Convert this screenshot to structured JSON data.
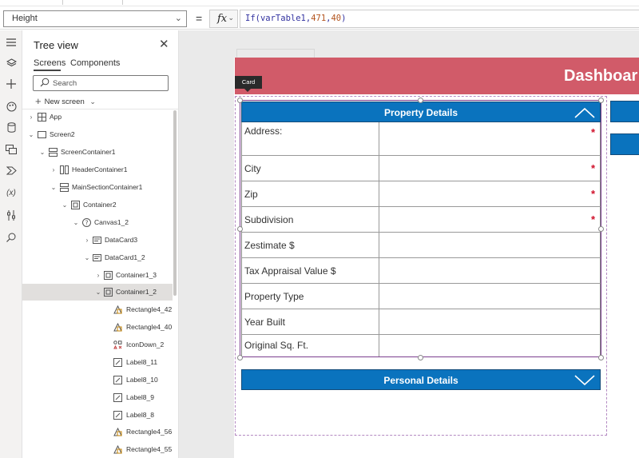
{
  "formula_bar": {
    "property": "Height",
    "fx_label": "fx",
    "formula_prefix": "If(varTable1,",
    "formula_num1": "471",
    "formula_comma": ",",
    "formula_num2": "40",
    "formula_suffix": ")"
  },
  "rail": {
    "icons": [
      "menu-icon",
      "layers-icon",
      "insert-icon",
      "theme-icon",
      "data-icon",
      "media-icon",
      "power-automate-icon",
      "variables-icon",
      "tools-icon",
      "search-icon"
    ]
  },
  "tree_view": {
    "title": "Tree view",
    "tabs": {
      "screens": "Screens",
      "components": "Components"
    },
    "search_placeholder": "Search",
    "new_screen": "New screen",
    "items": [
      {
        "label": "App"
      },
      {
        "label": "Screen2"
      },
      {
        "label": "ScreenContainer1"
      },
      {
        "label": "HeaderContainer1"
      },
      {
        "label": "MainSectionContainer1"
      },
      {
        "label": "Container2"
      },
      {
        "label": "Canvas1_2"
      },
      {
        "label": "DataCard3"
      },
      {
        "label": "DataCard1_2"
      },
      {
        "label": "Container1_3"
      },
      {
        "label": "Container1_2"
      },
      {
        "label": "Rectangle4_42"
      },
      {
        "label": "Rectangle4_40"
      },
      {
        "label": "IconDown_2"
      },
      {
        "label": "Label8_11"
      },
      {
        "label": "Label8_10"
      },
      {
        "label": "Label8_9"
      },
      {
        "label": "Label8_8"
      },
      {
        "label": "Rectangle4_56"
      },
      {
        "label": "Rectangle4_55"
      }
    ]
  },
  "canvas": {
    "header_title": "Dashboar",
    "card_tag": "Card",
    "property_section": "Property Details",
    "personal_section": "Personal Details",
    "required_mark": "*",
    "fields": [
      {
        "label": "Address:",
        "required": true
      },
      {
        "label": "City",
        "required": true
      },
      {
        "label": "Zip",
        "required": true
      },
      {
        "label": "Subdivision",
        "required": true
      },
      {
        "label": "Zestimate $",
        "required": false
      },
      {
        "label": "Tax Appraisal Value $",
        "required": false
      },
      {
        "label": "Property Type",
        "required": false
      },
      {
        "label": "Year Built",
        "required": false
      },
      {
        "label": "Original Sq. Ft.",
        "required": false
      }
    ],
    "colors": {
      "header": "#d15b69",
      "section": "#0a73be",
      "selection": "#7b3f8e",
      "required": "#d0102a"
    }
  }
}
